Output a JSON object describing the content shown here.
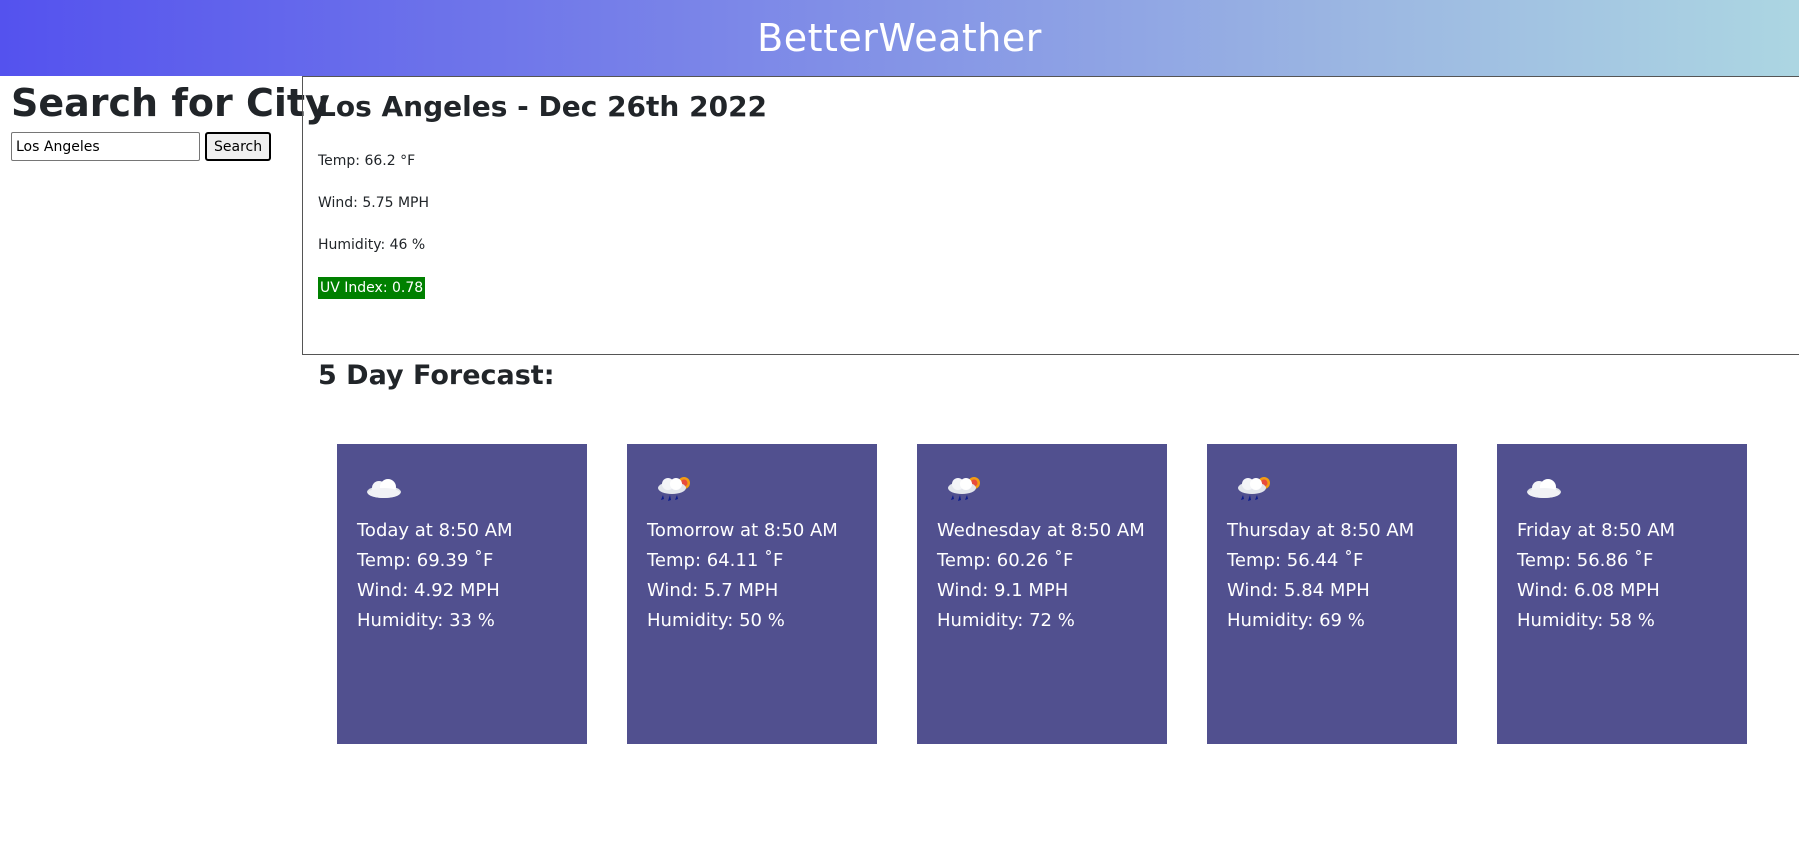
{
  "app": {
    "title": "BetterWeather"
  },
  "colors": {
    "card_bg": "#51508f",
    "uv_badge": "#008000"
  },
  "search": {
    "heading": "Search for City",
    "input_value": "Los Angeles",
    "button_label": "Search"
  },
  "current": {
    "heading": "Los Angeles - Dec 26th 2022",
    "temp": "Temp: 66.2 °F",
    "wind": "Wind: 5.75 MPH",
    "humidity": "Humidity: 46 %",
    "uv": "UV Index: 0.78"
  },
  "forecast": {
    "heading": "5 Day Forecast:",
    "days": [
      {
        "icon": "cloud-icon",
        "when": "Today at 8:50 AM",
        "temp": "Temp: 69.39 ˚F",
        "wind": "Wind: 4.92 MPH",
        "humidity": "Humidity: 33 %"
      },
      {
        "icon": "rain-sun-icon",
        "when": "Tomorrow at 8:50 AM",
        "temp": "Temp: 64.11 ˚F",
        "wind": "Wind: 5.7 MPH",
        "humidity": "Humidity: 50 %"
      },
      {
        "icon": "rain-sun-icon",
        "when": "Wednesday at 8:50 AM",
        "temp": "Temp: 60.26 ˚F",
        "wind": "Wind: 9.1 MPH",
        "humidity": "Humidity: 72 %"
      },
      {
        "icon": "rain-sun-icon",
        "when": "Thursday at 8:50 AM",
        "temp": "Temp: 56.44 ˚F",
        "wind": "Wind: 5.84 MPH",
        "humidity": "Humidity: 69 %"
      },
      {
        "icon": "cloud-icon",
        "when": "Friday at 8:50 AM",
        "temp": "Temp: 56.86 ˚F",
        "wind": "Wind: 6.08 MPH",
        "humidity": "Humidity: 58 %"
      }
    ]
  }
}
